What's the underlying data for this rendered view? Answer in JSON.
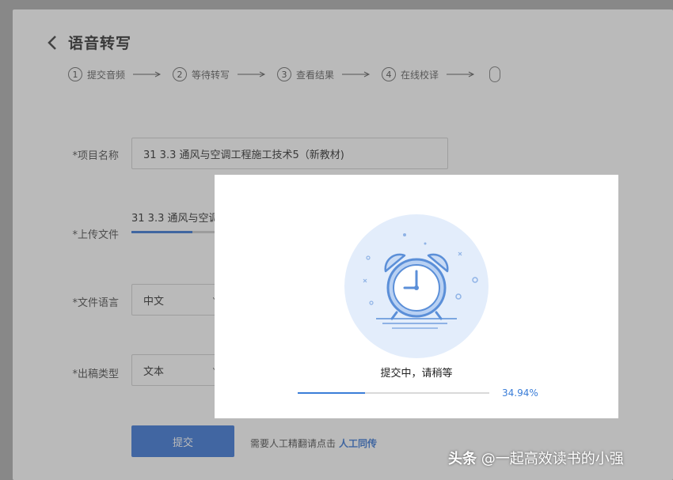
{
  "page": {
    "title": "语音转写",
    "steps": [
      {
        "num": "1",
        "label": "提交音频"
      },
      {
        "num": "2",
        "label": "等待转写"
      },
      {
        "num": "3",
        "label": "查看结果"
      },
      {
        "num": "4",
        "label": "在线校译"
      }
    ]
  },
  "form": {
    "project_name_label": "*项目名称",
    "project_name_value": "31 3.3 通风与空调工程施工技术5（新教材)",
    "upload_label": "*上传文件",
    "upload_filename": "31 3.3 通风与空调",
    "language_label": "*文件语言",
    "language_value": "中文",
    "output_label": "*出稿类型",
    "output_value": "文本",
    "submit_label": "提交",
    "manual_hint": "需要人工精翻请点击",
    "manual_link": "人工同传"
  },
  "modal": {
    "message": "提交中，请稍等",
    "progress_text": "34.94%",
    "progress_value": 34.94,
    "illustration": "alarm-clock-icon"
  },
  "watermark": {
    "brand": "头条",
    "handle": "@一起高效读书的小强"
  },
  "colors": {
    "accent": "#2f6fd6",
    "progress": "#3a7dd8",
    "circle_bg": "#e3edfb"
  }
}
